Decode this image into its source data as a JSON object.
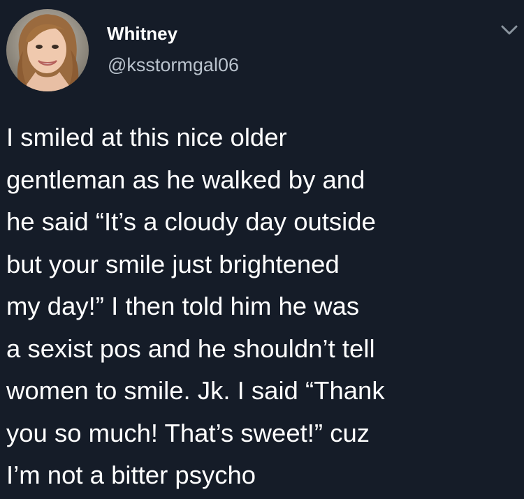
{
  "theme": {
    "background": "#151c28",
    "text": "#ffffff",
    "handle_color": "#b9c2cc",
    "chevron_color": "#8a949e"
  },
  "author": {
    "name": "Whitney",
    "handle": "@ksstormgal06",
    "avatar_icon": "profile-photo"
  },
  "header": {
    "more_icon": "chevron-down-icon"
  },
  "tweet": {
    "lines": [
      "I smiled at this nice older",
      "gentleman as he walked by and",
      "he said “It’s a cloudy day outside",
      "but your smile just brightened",
      "my day!” I then told him he was",
      "a sexist pos and he shouldn’t tell",
      "women to smile. Jk. I said “Thank",
      "you so much! That’s sweet!” cuz",
      "I’m not a bitter psycho"
    ]
  }
}
